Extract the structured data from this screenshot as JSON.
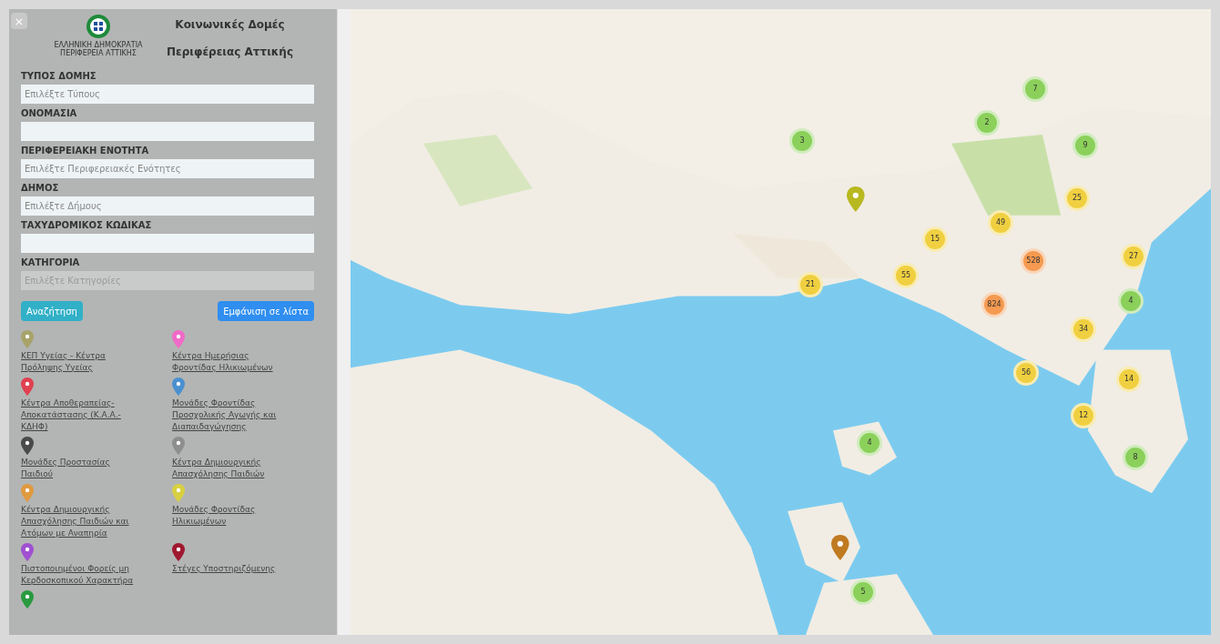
{
  "close_button": "×",
  "header": {
    "title_line1": "Κοινωνικές Δομές",
    "title_line2": "Περιφέρειας Αττικής",
    "logo_caption": "ΕΛΛΗΝΙΚΗ ΔΗΜΟΚΡΑΤΙΑ ΠΕΡΙΦΕΡΕΙΑ ΑΤΤΙΚΗΣ"
  },
  "filters": [
    {
      "label": "ΤΥΠΟΣ ΔΟΜΗΣ",
      "placeholder": "Επιλέξτε Τύπους",
      "disabled": false
    },
    {
      "label": "ΟΝΟΜΑΣΙΑ",
      "disabled": false
    },
    {
      "label": "ΠΕΡΙΦΕΡΕΙΑΚΗ ΕΝΟΤΗΤΑ",
      "placeholder": "Επιλέξτε Περιφερειακές Ενότητες",
      "disabled": false
    },
    {
      "label": "ΔΗΜΟΣ",
      "placeholder": "Επιλέξτε Δήμους",
      "disabled": false
    },
    {
      "label": "ΤΑΧΥΔΡΟΜΙΚΟΣ ΚΩΔΙΚΑΣ",
      "disabled": false
    },
    {
      "label": "ΚΑΤΗΓΟΡΙΑ",
      "placeholder": "Επιλέξτε Κατηγορίες",
      "disabled": true
    }
  ],
  "buttons": {
    "search": "Αναζήτηση",
    "list_view": "Εμφάνιση σε λίστα"
  },
  "legend": [
    {
      "label": "ΚΕΠ Υγείας - Κέντρα Πρόληψης Υγείας",
      "color": "#a8a36a"
    },
    {
      "label": "Κέντρα Ημερήσιας Φροντίδας Ηλικιωμένων",
      "color": "#f06ac8"
    },
    {
      "label": "Κέντρα Αποθεραπείας-Αποκατάστασης (Κ.Α.Α.-ΚΔΗΦ)",
      "color": "#e04050"
    },
    {
      "label": "Μονάδες Φροντίδας Προσχολικής Αγωγής και Διαπαιδαγώγησης",
      "color": "#4a90d0"
    },
    {
      "label": "Μονάδες Προστασίας Παιδιού",
      "color": "#4a4a4a"
    },
    {
      "label": "Κέντρα Δημιουργικής Απασχόλησης Παιδιών",
      "color": "#8e8e8e"
    },
    {
      "label": "Κέντρα Δημιουργικής Απασχόλησης Παιδιών και Ατόμων με Αναπηρία",
      "color": "#e09a40"
    },
    {
      "label": "Μονάδες Φροντίδας Ηλικιωμένων",
      "color": "#d8d040"
    },
    {
      "label": "Πιστοποιημένοι Φορείς μη Κερδοσκοπικού Χαρακτήρα",
      "color": "#a050d0"
    },
    {
      "label": "Στέγες Υποστηριζόμενης",
      "color": "#a01830"
    },
    {
      "color": "#2a9a40"
    }
  ],
  "map": {
    "kind": "picture",
    "clusters": [
      {
        "count": "7",
        "color": "#8bd05a"
      },
      {
        "count": "2",
        "color": "#8bd05a"
      },
      {
        "count": "3",
        "color": "#8bd05a"
      },
      {
        "count": "9",
        "color": "#8bd05a"
      },
      {
        "count": "25",
        "color": "#f0d040"
      },
      {
        "count": "49",
        "color": "#f0d040"
      },
      {
        "count": "15",
        "color": "#f0d040"
      },
      {
        "count": "528",
        "color": "#f59a50"
      },
      {
        "count": "27",
        "color": "#f0d040"
      },
      {
        "count": "55",
        "color": "#f0d040"
      },
      {
        "count": "21",
        "color": "#f0d040"
      },
      {
        "count": "824",
        "color": "#f59a50"
      },
      {
        "count": "4",
        "color": "#8bd05a"
      },
      {
        "count": "34",
        "color": "#f0d040"
      },
      {
        "count": "56",
        "color": "#f0d040"
      },
      {
        "count": "14",
        "color": "#f0d040"
      },
      {
        "count": "12",
        "color": "#f0d040"
      },
      {
        "count": "4",
        "color": "#8bd05a"
      },
      {
        "count": "8",
        "color": "#8bd05a"
      },
      {
        "count": "5",
        "color": "#8bd05a"
      }
    ],
    "pins": [
      {
        "color": "#b8b820"
      },
      {
        "color": "#c07a20"
      }
    ]
  }
}
